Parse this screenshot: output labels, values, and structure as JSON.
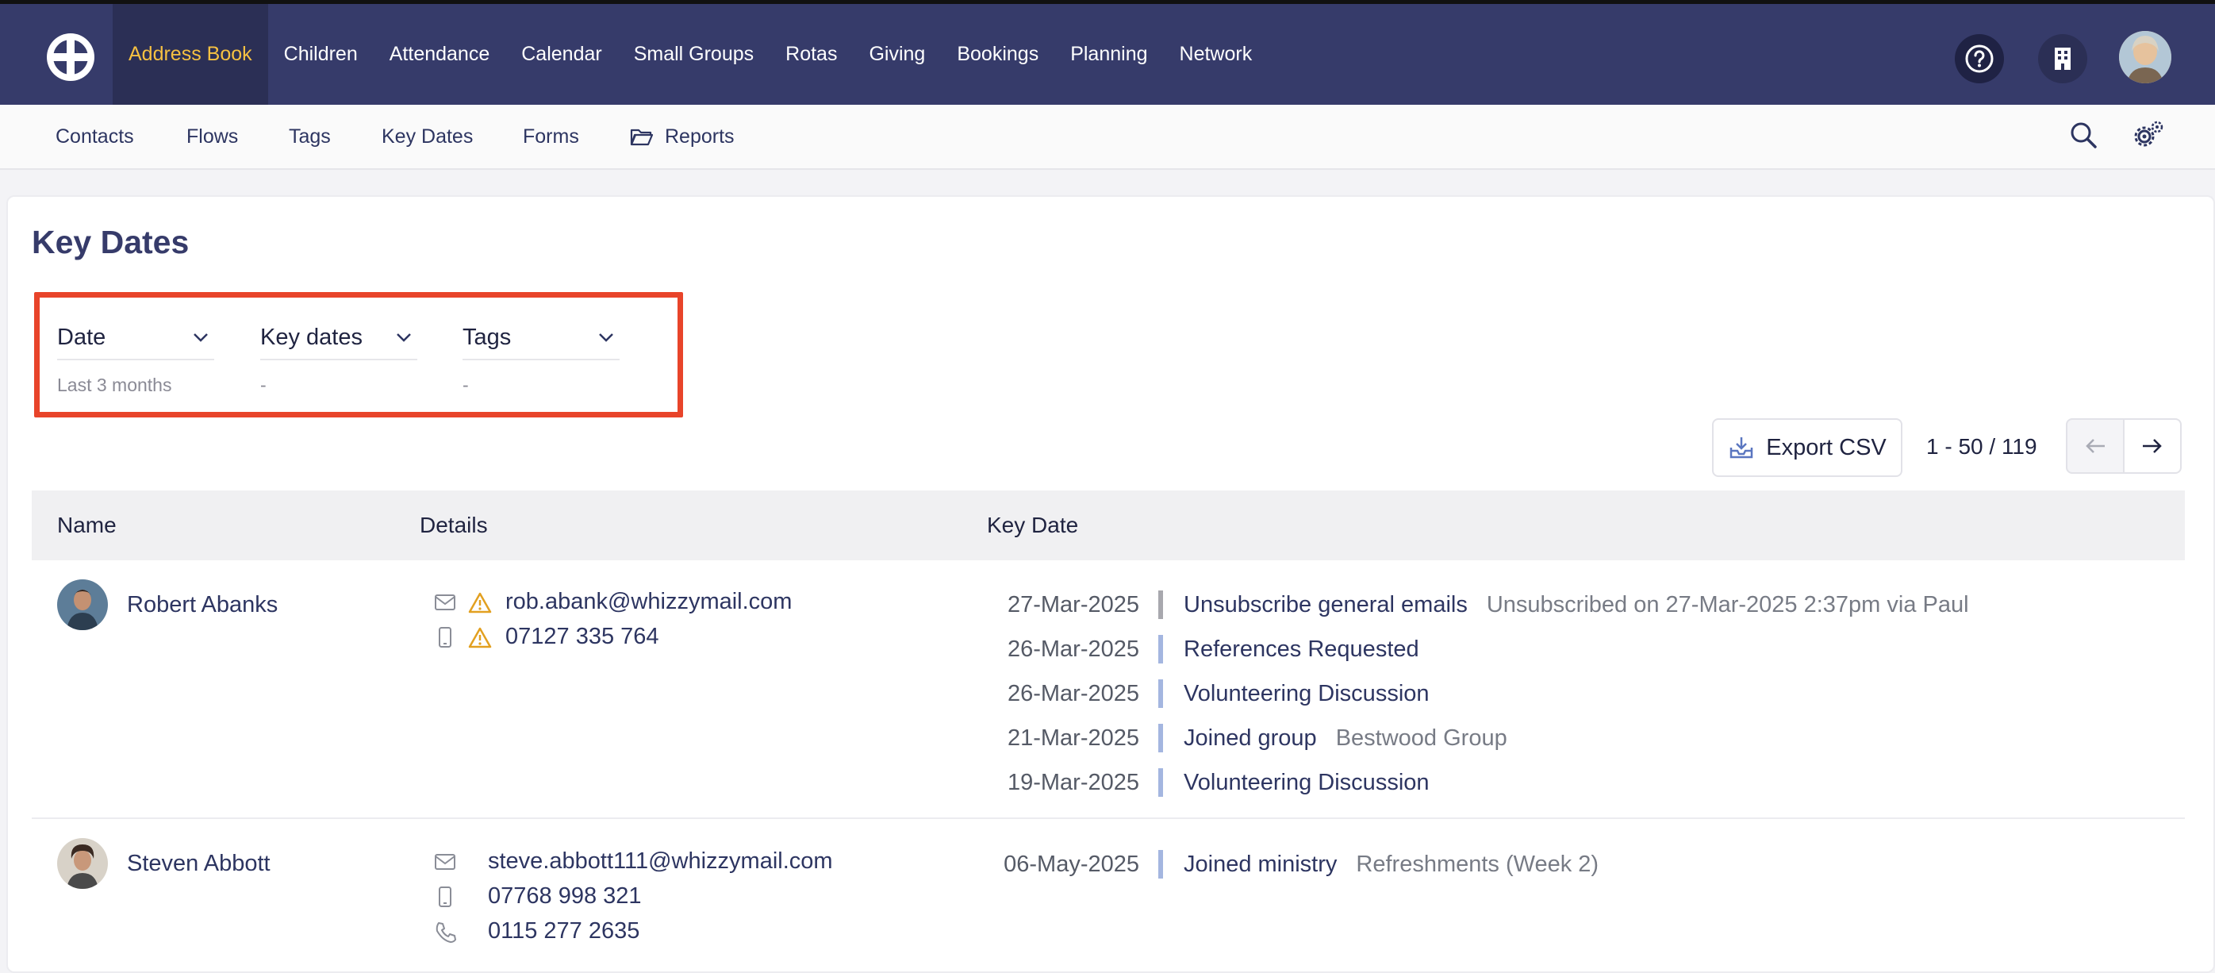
{
  "topnav": {
    "items": [
      {
        "label": "Address Book",
        "active": true
      },
      {
        "label": "Children"
      },
      {
        "label": "Attendance"
      },
      {
        "label": "Calendar"
      },
      {
        "label": "Small Groups"
      },
      {
        "label": "Rotas"
      },
      {
        "label": "Giving"
      },
      {
        "label": "Bookings"
      },
      {
        "label": "Planning"
      },
      {
        "label": "Network"
      }
    ],
    "icons": [
      "help-icon",
      "building-icon",
      "user-avatar"
    ]
  },
  "subnav": {
    "items": [
      {
        "label": "Contacts"
      },
      {
        "label": "Flows"
      },
      {
        "label": "Tags"
      },
      {
        "label": "Key Dates"
      },
      {
        "label": "Forms"
      },
      {
        "label": "Reports",
        "icon": "folder-icon"
      }
    ],
    "icons": [
      "search-icon",
      "settings-icon"
    ]
  },
  "page": {
    "title": "Key Dates"
  },
  "filters": [
    {
      "label": "Date",
      "value": "Last 3 months"
    },
    {
      "label": "Key dates",
      "value": "-"
    },
    {
      "label": "Tags",
      "value": "-"
    }
  ],
  "toolbar": {
    "export_label": "Export CSV",
    "pager_text": "1 - 50 / 119"
  },
  "table": {
    "headers": [
      "Name",
      "Details",
      "Key Date"
    ],
    "rows": [
      {
        "name": "Robert Abanks",
        "email": "rob.abank@whizzymail.com",
        "mobile": "07127 335 764",
        "warnings": true,
        "key_dates": [
          {
            "date": "27-Mar-2025",
            "event": "Unsubscribe general emails",
            "extra": "Unsubscribed on 27-Mar-2025 2:37pm via Paul",
            "bar": "grey"
          },
          {
            "date": "26-Mar-2025",
            "event": "References Requested",
            "extra": ""
          },
          {
            "date": "26-Mar-2025",
            "event": "Volunteering Discussion",
            "extra": ""
          },
          {
            "date": "21-Mar-2025",
            "event": "Joined group",
            "extra": "Bestwood Group"
          },
          {
            "date": "19-Mar-2025",
            "event": "Volunteering Discussion",
            "extra": ""
          }
        ]
      },
      {
        "name": "Steven Abbott",
        "email": "steve.abbott111@whizzymail.com",
        "mobile": "07768 998 321",
        "phone": "0115 277 2635",
        "warnings": false,
        "key_dates": [
          {
            "date": "06-May-2025",
            "event": "Joined ministry",
            "extra": "Refreshments (Week 2)"
          }
        ]
      }
    ]
  },
  "colors": {
    "topbar": "#363b6a",
    "active_nav_text": "#f6c142",
    "highlight_border": "#e8442a",
    "keydate_bar": "#a4b6e0"
  }
}
